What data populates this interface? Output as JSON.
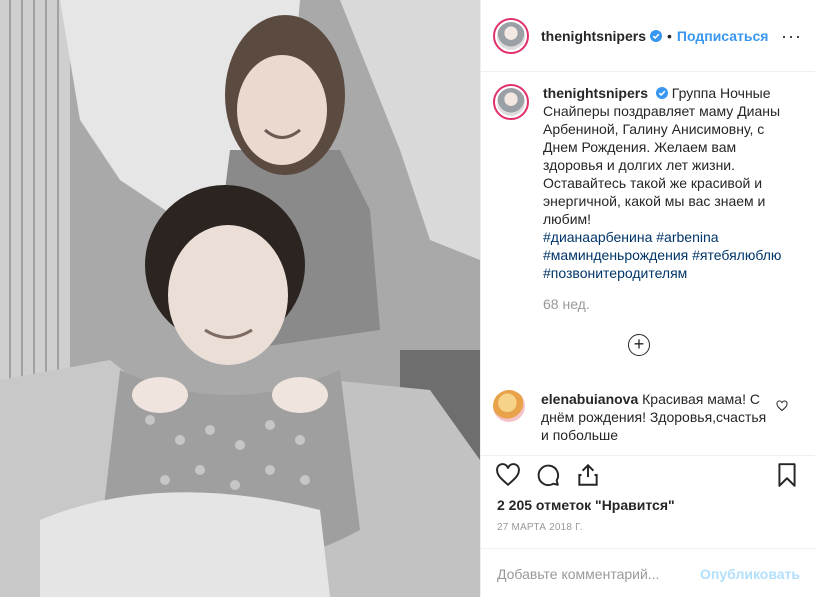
{
  "post": {
    "username": "thenightsnipers",
    "header_dot": "•",
    "follow_label": "Подписаться",
    "more_label": "···",
    "caption": "Группа Ночные Снайперы поздравляет маму Дианы Арбениной, Галину Анисимовну, с Днем Рождения. Желаем вам здоровья и долгих лет жизни. Оставайтесь такой же красивой и энергичной, какой мы вас знаем и любим!",
    "hashtags": "#дианаарбенина #arbenina #маминденьрождения #ятебялюблю #позвонитеродителям",
    "time_ago": "68 нед.",
    "load_more_label": "+"
  },
  "comment": {
    "username": "elenabuianova",
    "text": "Красивая мама! С днём рождения! Здоровья,счастья и побольше"
  },
  "footer": {
    "likes": "2 205 отметок \"Нравится\"",
    "date": "27 МАРТА 2018 Г.",
    "comment_placeholder": "Добавьте комментарий...",
    "publish_label": "Опубликовать"
  },
  "icons": [
    "heart-icon",
    "comment-icon",
    "share-icon",
    "bookmark-icon",
    "verified-icon",
    "heart-small-icon"
  ],
  "colors": {
    "accent": "#3897f0",
    "publish_disabled": "#b2dffc",
    "hashtag": "#003569",
    "muted": "#999999"
  }
}
